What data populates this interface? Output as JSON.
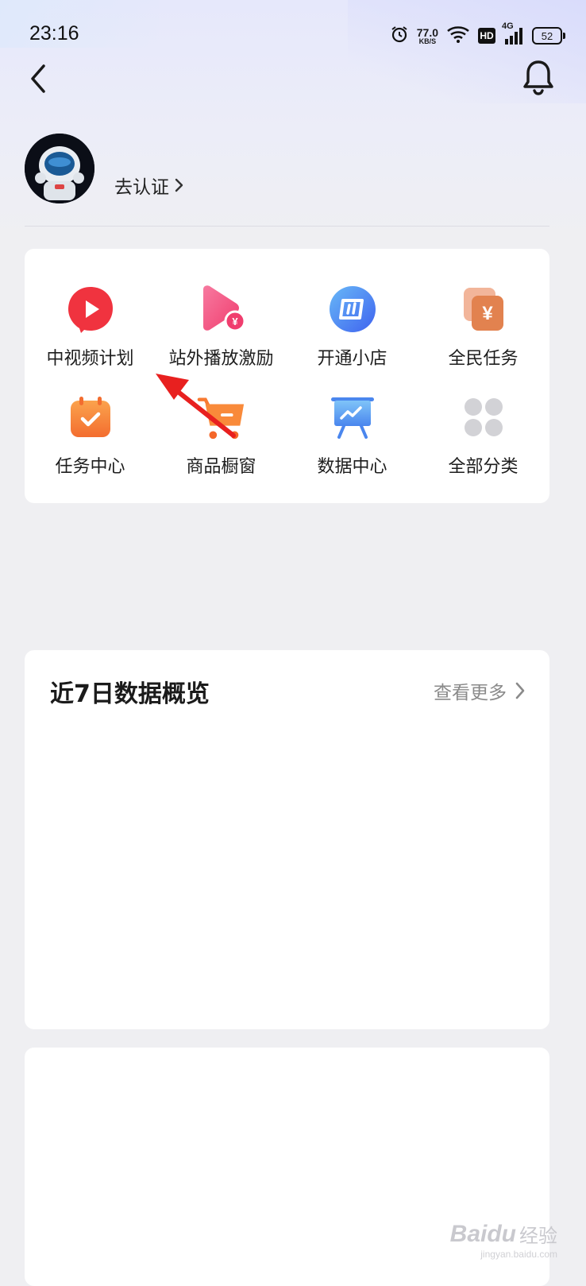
{
  "status_bar": {
    "time": "23:16",
    "net_speed_value": "77.0",
    "net_speed_unit": "KB/S",
    "hd": "HD",
    "network": "4G",
    "battery": "52",
    "icons": [
      "alarm-icon",
      "wifi-icon",
      "signal-icon",
      "battery-icon"
    ]
  },
  "header": {
    "back_icon": "chevron-left-icon",
    "notification_icon": "bell-icon"
  },
  "profile": {
    "verify_label": "去认证"
  },
  "shortcuts": [
    {
      "label": "中视频计划",
      "icon": "video-play-icon",
      "color": "#f0333f"
    },
    {
      "label": "站外播放激励",
      "icon": "play-reward-icon",
      "color": "#f55684"
    },
    {
      "label": "开通小店",
      "icon": "shop-icon",
      "color": "#4f7af4"
    },
    {
      "label": "全民任务",
      "icon": "coupon-icon",
      "color": "#e98b5a"
    },
    {
      "label": "任务中心",
      "icon": "calendar-check-icon",
      "color": "#f47a35"
    },
    {
      "label": "商品橱窗",
      "icon": "cart-icon",
      "color": "#f77a32"
    },
    {
      "label": "数据中心",
      "icon": "chart-board-icon",
      "color": "#5297f1"
    },
    {
      "label": "全部分类",
      "icon": "grid-icon",
      "color": "#d2d2d6"
    }
  ],
  "overview": {
    "title": "近7日数据概览",
    "view_more": "查看更多"
  },
  "watermark": {
    "brand": "Baidu",
    "suffix": "经验",
    "site": "jingyan.baidu.com"
  },
  "colors": {
    "annotation_arrow": "#e8201f",
    "background": "#efeff2"
  }
}
